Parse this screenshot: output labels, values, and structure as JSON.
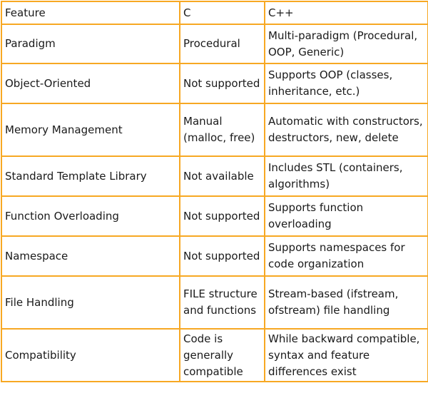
{
  "table": {
    "header": {
      "feature": "Feature",
      "c": "C",
      "cpp": "C++"
    },
    "rows": [
      {
        "feature": "Paradigm",
        "c": "Procedural",
        "cpp": "Multi-paradigm (Procedural, OOP, Generic)"
      },
      {
        "feature": "Object-Oriented",
        "c": "Not supported",
        "cpp": "Supports OOP (classes, inheritance, etc.)"
      },
      {
        "feature": "Memory Management",
        "c": "Manual (malloc, free)",
        "cpp": "Automatic with constructors, destructors, new, delete"
      },
      {
        "feature": "Standard Template Library",
        "c": "Not available",
        "cpp": "Includes STL (containers, algorithms)"
      },
      {
        "feature": "Function Overloading",
        "c": "Not supported",
        "cpp": "Supports function overloading"
      },
      {
        "feature": "Namespace",
        "c": "Not supported",
        "cpp": "Supports namespaces for code organization"
      },
      {
        "feature": "File Handling",
        "c": "FILE structure and functions",
        "cpp": "Stream-based (ifstream, ofstream) file handling"
      },
      {
        "feature": "Compatibility",
        "c": "Code is generally compatible",
        "cpp": "While backward compatible, syntax and feature differences exist"
      }
    ],
    "border_color": "#f7a823"
  }
}
